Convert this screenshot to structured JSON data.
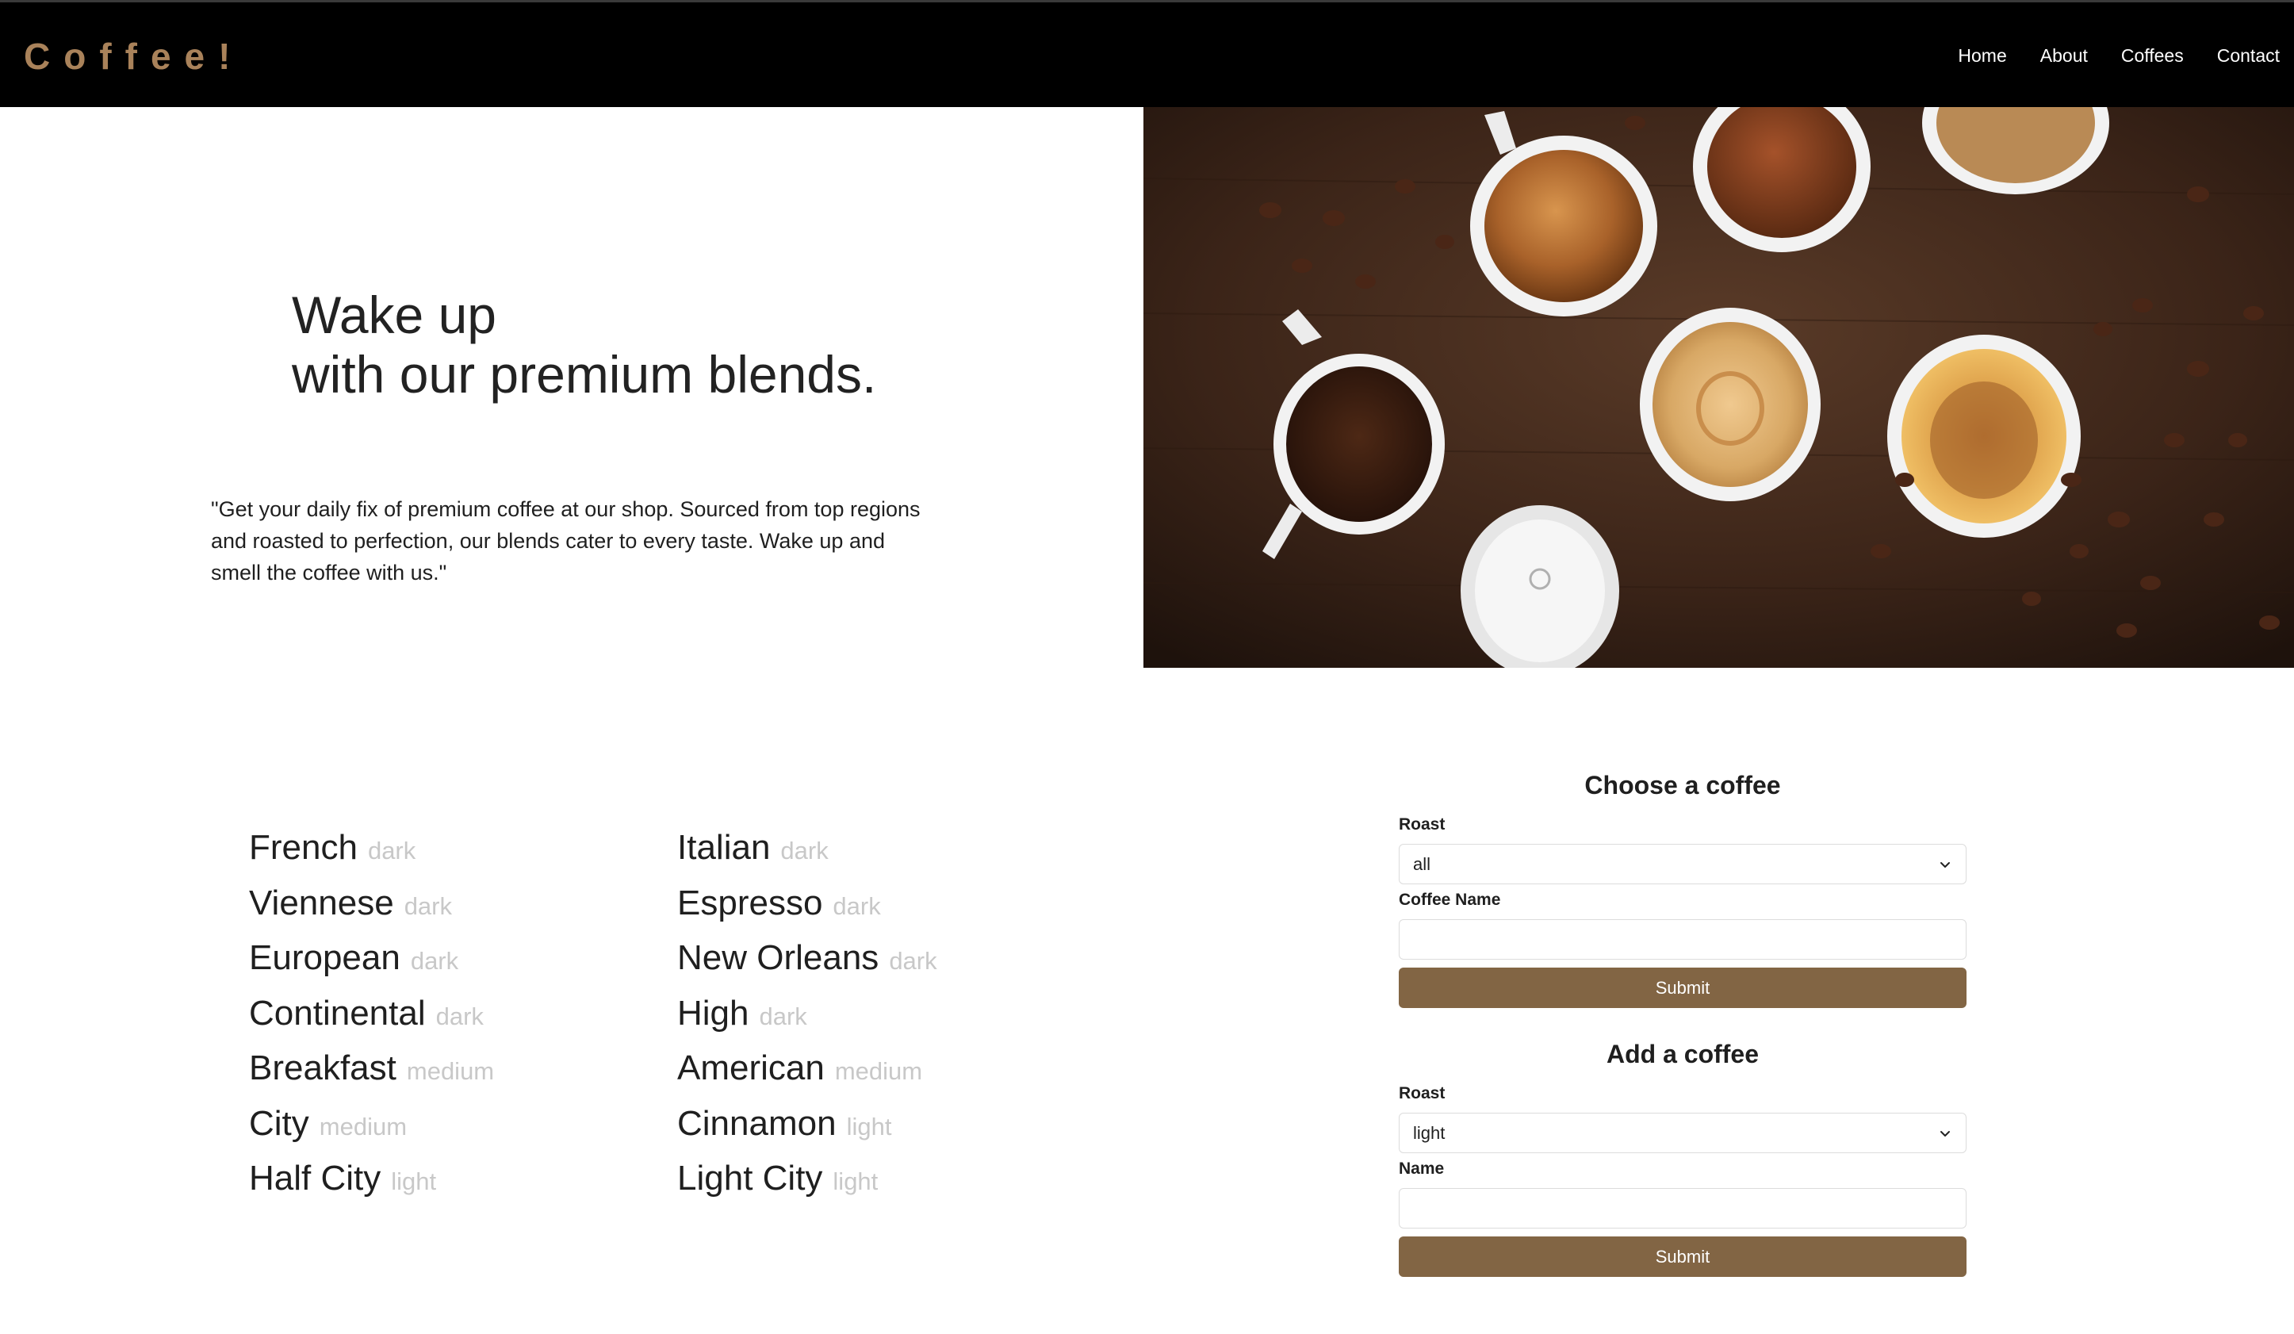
{
  "brand": {
    "name": "Coffee!"
  },
  "nav": {
    "items": [
      {
        "label": "Home"
      },
      {
        "label": "About"
      },
      {
        "label": "Coffees"
      },
      {
        "label": "Contact"
      }
    ]
  },
  "hero": {
    "title_line1": "Wake up",
    "title_line2": "with our premium blends.",
    "text": "\"Get your daily fix of premium coffee at our shop. Sourced from top regions and roasted to perfection, our blends cater to every taste. Wake up and smell the coffee with us.\"",
    "image_icon": "coffee-cups-photo"
  },
  "coffees": [
    {
      "name": "French",
      "roast": "dark"
    },
    {
      "name": "Viennese",
      "roast": "dark"
    },
    {
      "name": "European",
      "roast": "dark"
    },
    {
      "name": "Continental",
      "roast": "dark"
    },
    {
      "name": "Breakfast",
      "roast": "medium"
    },
    {
      "name": "City",
      "roast": "medium"
    },
    {
      "name": "Half City",
      "roast": "light"
    },
    {
      "name": "Italian",
      "roast": "dark"
    },
    {
      "name": "Espresso",
      "roast": "dark"
    },
    {
      "name": "New Orleans",
      "roast": "dark"
    },
    {
      "name": "High",
      "roast": "dark"
    },
    {
      "name": "American",
      "roast": "medium"
    },
    {
      "name": "Cinnamon",
      "roast": "light"
    },
    {
      "name": "Light City",
      "roast": "light"
    }
  ],
  "choose_form": {
    "title": "Choose a coffee",
    "roast_label": "Roast",
    "roast_value": "all",
    "name_label": "Coffee Name",
    "name_value": "",
    "submit_label": "Submit"
  },
  "add_form": {
    "title": "Add a coffee",
    "roast_label": "Roast",
    "roast_value": "light",
    "name_label": "Name",
    "name_value": "",
    "submit_label": "Submit"
  },
  "colors": {
    "header_bg": "#000000",
    "brand": "#a9825a",
    "button": "#826544",
    "roast_text": "#c8c8c8"
  }
}
